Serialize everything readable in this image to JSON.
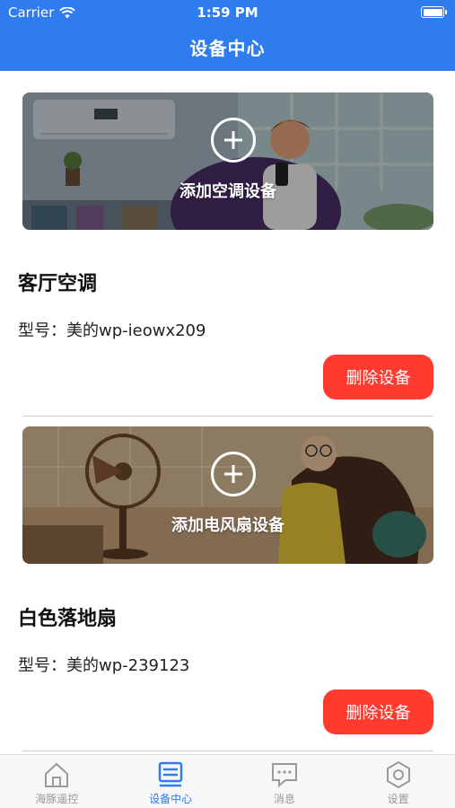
{
  "status_bar": {
    "carrier": "Carrier",
    "time": "1:59 PM"
  },
  "header": {
    "title": "设备中心"
  },
  "devices": [
    {
      "banner_label": "添加空调设备",
      "name": "客厅空调",
      "model": "型号：美的wp-ieowx209",
      "delete_label": "删除设备"
    },
    {
      "banner_label": "添加电风扇设备",
      "name": "白色落地扇",
      "model": "型号：美的wp-239123",
      "delete_label": "删除设备"
    }
  ],
  "tabbar": {
    "tabs": [
      {
        "label": "海豚遥控",
        "icon": "home-icon",
        "active": false
      },
      {
        "label": "设备中心",
        "icon": "device-list-icon",
        "active": true
      },
      {
        "label": "消息",
        "icon": "message-icon",
        "active": false
      },
      {
        "label": "设置",
        "icon": "settings-icon",
        "active": false
      }
    ]
  },
  "colors": {
    "primary": "#2f7bf0",
    "danger": "#ff3b30",
    "inactive_tab": "#9a9a9a"
  }
}
